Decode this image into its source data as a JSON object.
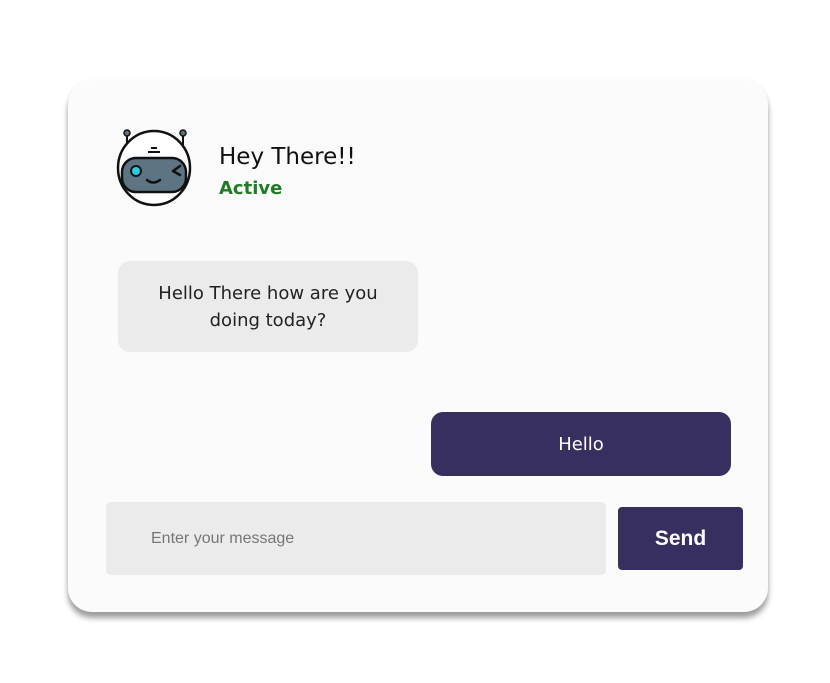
{
  "header": {
    "title": "Hey There!!",
    "status": "Active",
    "status_color": "#1e7d23",
    "avatar_icon": "robot-icon"
  },
  "messages": [
    {
      "from": "bot",
      "text": "Hello There how are you doing today?"
    },
    {
      "from": "user",
      "text": "Hello"
    }
  ],
  "composer": {
    "placeholder": "Enter your message",
    "value": "",
    "send_label": "Send"
  },
  "colors": {
    "accent": "#372f60",
    "bot_bubble": "#ebebeb",
    "card": "#fbfbfb"
  }
}
